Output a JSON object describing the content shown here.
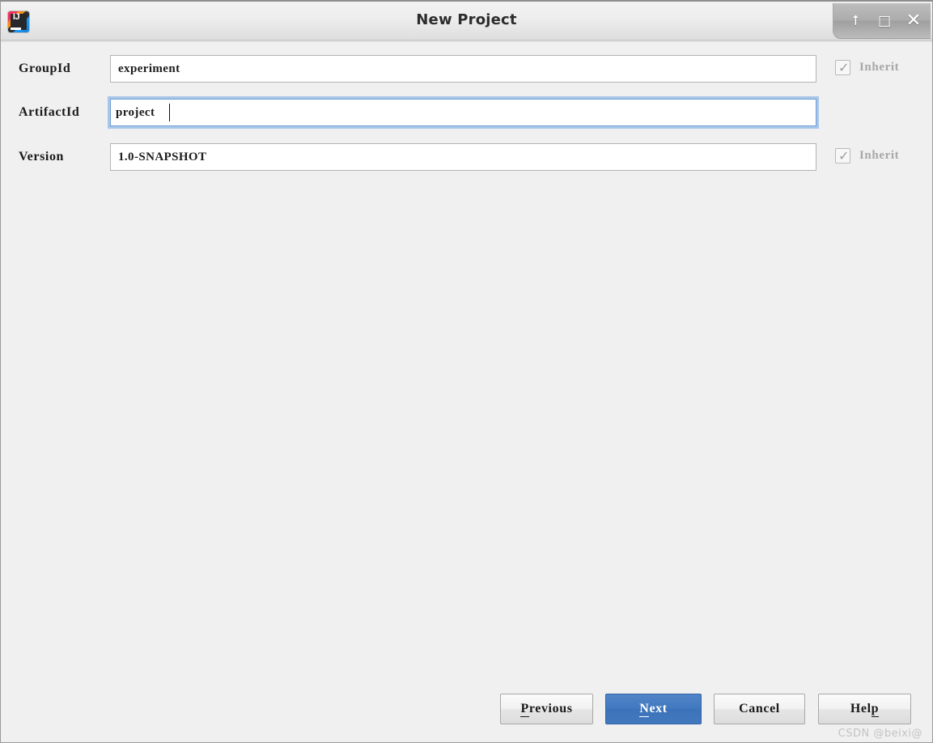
{
  "window": {
    "title": "New Project",
    "app_icon": "intellij-idea-icon",
    "icon_letters": "IJ",
    "controls": [
      {
        "name": "shade-button",
        "glyph": "⭡"
      },
      {
        "name": "maximize-button",
        "glyph": "□"
      },
      {
        "name": "close-button",
        "glyph": "✕"
      }
    ]
  },
  "form": {
    "fields": [
      {
        "label": "GroupId",
        "value": "experiment",
        "placeholder": "",
        "focused": false,
        "inherit": {
          "label": "Inherit",
          "checked": true,
          "enabled": false,
          "tick": "✓"
        }
      },
      {
        "label": "ArtifactId",
        "value": "project",
        "placeholder": "",
        "focused": true,
        "inherit": null
      },
      {
        "label": "Version",
        "value": "1.0-SNAPSHOT",
        "placeholder": "",
        "focused": false,
        "inherit": {
          "label": "Inherit",
          "checked": true,
          "enabled": false,
          "tick": "✓"
        }
      }
    ]
  },
  "buttons": {
    "previous": {
      "mnemonic": "P",
      "rest": "revious",
      "default": false
    },
    "next": {
      "mnemonic": "N",
      "rest": "ext",
      "default": true
    },
    "cancel": {
      "label": "Cancel",
      "default": false
    },
    "help": {
      "pre": "Hel",
      "mnemonic": "p",
      "default": false
    }
  },
  "watermark": "CSDN @beixi@",
  "colors": {
    "dialog_background": "#f0f0f0",
    "titlebar_top": "#f3f3f3",
    "titlebar_bottom": "#dedede",
    "default_button_blue": "#3f76c0",
    "focus_ring": "#a8c6e8",
    "disabled_text": "#a7a7a7",
    "watermark": "#c3c3c3"
  }
}
